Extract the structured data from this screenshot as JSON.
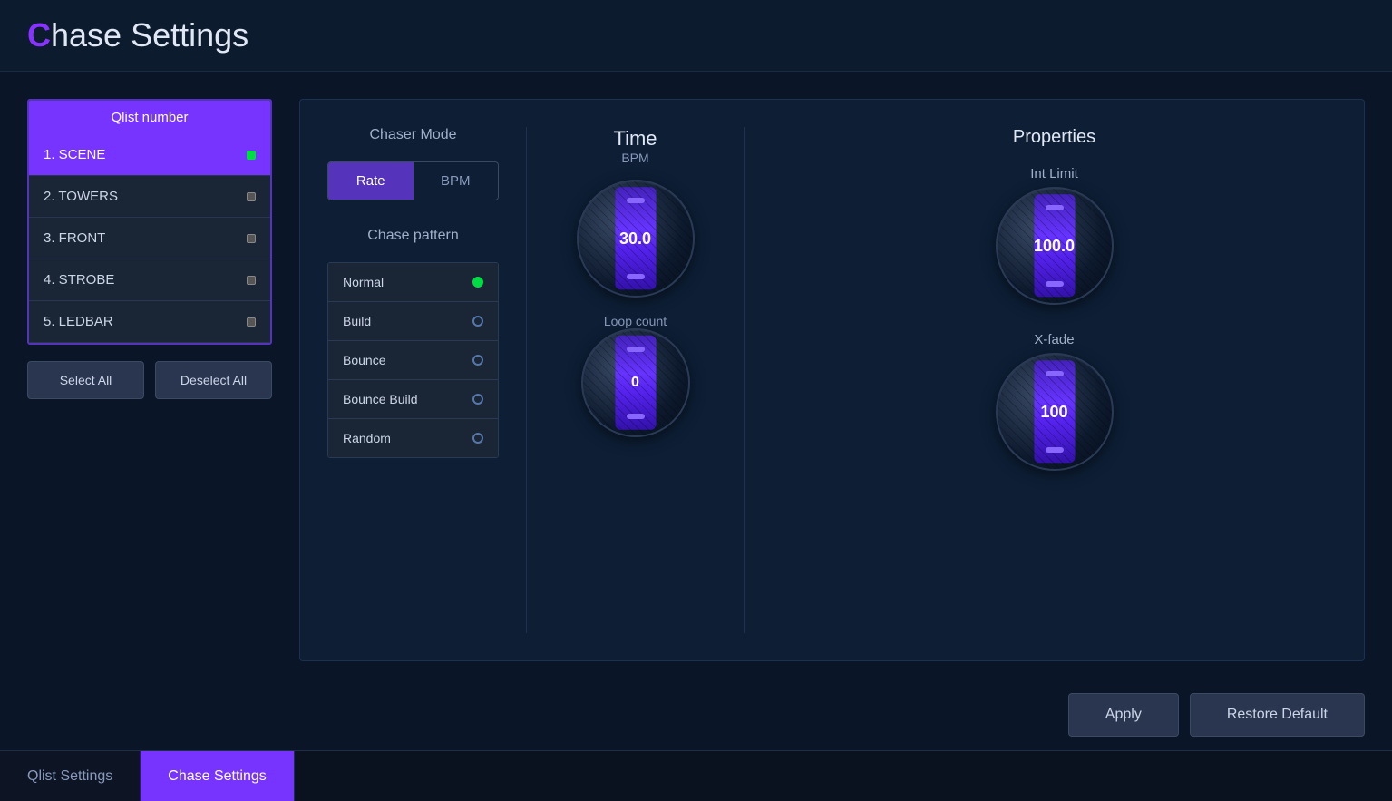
{
  "header": {
    "title_prefix": "C",
    "title_rest": "hase Settings"
  },
  "qlist": {
    "header_label": "Qlist number",
    "items": [
      {
        "id": 1,
        "label": "1. SCENE",
        "active": true
      },
      {
        "id": 2,
        "label": "2. TOWERS",
        "active": false
      },
      {
        "id": 3,
        "label": "3. FRONT",
        "active": false
      },
      {
        "id": 4,
        "label": "4. STROBE",
        "active": false
      },
      {
        "id": 5,
        "label": "5. LEDBAR",
        "active": false
      }
    ],
    "select_all_label": "Select All",
    "deselect_all_label": "Deselect All"
  },
  "chaser_mode": {
    "title": "Chaser Mode",
    "tabs": [
      {
        "id": "rate",
        "label": "Rate",
        "active": true
      },
      {
        "id": "bpm",
        "label": "BPM",
        "active": false
      }
    ]
  },
  "chase_pattern": {
    "title": "Chase pattern",
    "items": [
      {
        "id": "normal",
        "label": "Normal",
        "selected": true
      },
      {
        "id": "build",
        "label": "Build",
        "selected": false
      },
      {
        "id": "bounce",
        "label": "Bounce",
        "selected": false
      },
      {
        "id": "bounce_build",
        "label": "Bounce Build",
        "selected": false
      },
      {
        "id": "random",
        "label": "Random",
        "selected": false
      }
    ]
  },
  "time": {
    "title": "Time",
    "subtitle": "BPM",
    "value": "30.0",
    "loop_count_label": "Loop count",
    "loop_count_value": "0"
  },
  "properties": {
    "title": "Properties",
    "int_limit_label": "Int Limit",
    "int_limit_value": "100.0",
    "xfade_label": "X-fade",
    "xfade_value": "100"
  },
  "buttons": {
    "apply_label": "Apply",
    "restore_default_label": "Restore Default"
  },
  "bottom_tabs": [
    {
      "id": "qlist",
      "label": "Qlist Settings",
      "active": false
    },
    {
      "id": "chase",
      "label": "Chase Settings",
      "active": true
    }
  ]
}
